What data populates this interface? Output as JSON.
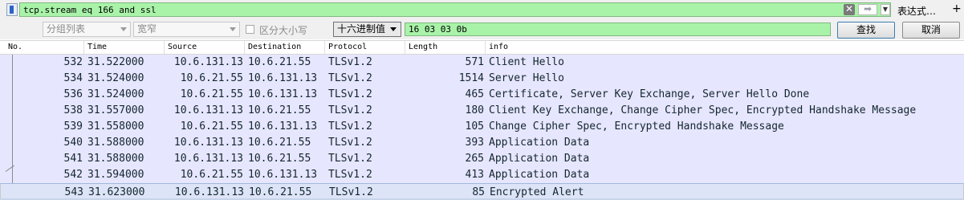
{
  "filter": {
    "text": "tcp.stream eq 166 and ssl",
    "clear_glyph": "✕",
    "apply_glyph": "➡",
    "recent_glyph": "▼",
    "expression_label": "表达式…",
    "plus_label": "+",
    "background": "#a9f3a9"
  },
  "search": {
    "scope": "分组列表",
    "charset": "宽窄",
    "case_label": "区分大小写",
    "type": "十六进制值",
    "value": "16 03 03 0b",
    "find_label": "查找",
    "cancel_label": "取消"
  },
  "columns": [
    "No.",
    "Time",
    "Source",
    "Destination",
    "Protocol",
    "Length",
    "info"
  ],
  "packets": [
    {
      "no": "532",
      "time": "31.522000",
      "src": "10.6.131.13",
      "dst": "10.6.21.55",
      "proto": "TLSv1.2",
      "len": "571",
      "info": "Client Hello"
    },
    {
      "no": "534",
      "time": "31.524000",
      "src": "10.6.21.55",
      "dst": "10.6.131.13",
      "proto": "TLSv1.2",
      "len": "1514",
      "info": "Server Hello"
    },
    {
      "no": "536",
      "time": "31.524000",
      "src": "10.6.21.55",
      "dst": "10.6.131.13",
      "proto": "TLSv1.2",
      "len": "465",
      "info": "Certificate, Server Key Exchange, Server Hello Done"
    },
    {
      "no": "538",
      "time": "31.557000",
      "src": "10.6.131.13",
      "dst": "10.6.21.55",
      "proto": "TLSv1.2",
      "len": "180",
      "info": "Client Key Exchange, Change Cipher Spec, Encrypted Handshake Message"
    },
    {
      "no": "539",
      "time": "31.558000",
      "src": "10.6.21.55",
      "dst": "10.6.131.13",
      "proto": "TLSv1.2",
      "len": "105",
      "info": "Change Cipher Spec, Encrypted Handshake Message"
    },
    {
      "no": "540",
      "time": "31.588000",
      "src": "10.6.131.13",
      "dst": "10.6.21.55",
      "proto": "TLSv1.2",
      "len": "393",
      "info": "Application Data"
    },
    {
      "no": "541",
      "time": "31.588000",
      "src": "10.6.131.13",
      "dst": "10.6.21.55",
      "proto": "TLSv1.2",
      "len": "265",
      "info": "Application Data"
    },
    {
      "no": "542",
      "time": "31.594000",
      "src": "10.6.21.55",
      "dst": "10.6.131.13",
      "proto": "TLSv1.2",
      "len": "413",
      "info": "Application Data"
    },
    {
      "no": "543",
      "time": "31.623000",
      "src": "10.6.131.13",
      "dst": "10.6.21.55",
      "proto": "TLSv1.2",
      "len": "85",
      "info": "Encrypted Alert"
    }
  ],
  "row_color": "#e7e6ff"
}
